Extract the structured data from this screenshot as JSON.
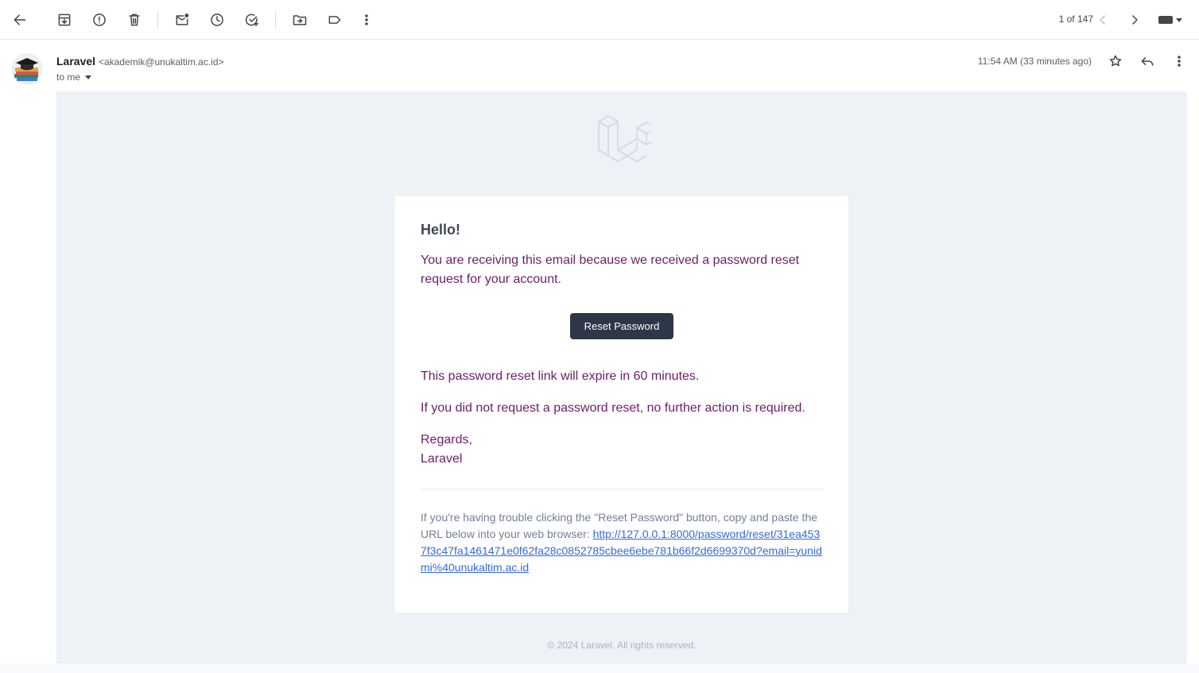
{
  "toolbar": {
    "icons": [
      "back-arrow-icon",
      "archive-icon",
      "report-spam-icon",
      "delete-icon",
      "mark-unread-icon",
      "snooze-icon",
      "add-task-icon",
      "move-to-icon",
      "label-icon",
      "more-vert-icon"
    ],
    "pager": "1 of 147"
  },
  "header": {
    "sender_name": "Laravel",
    "sender_email": "<akademik@unukaltim.ac.id>",
    "to": "to me",
    "time": "11:54 AM (33 minutes ago)"
  },
  "email": {
    "greeting": "Hello!",
    "intro": "You are receiving this email because we received a password reset request for your account.",
    "button_label": "Reset Password",
    "expire": "This password reset link will expire in 60 minutes.",
    "no_action": "If you did not request a password reset, no further action is required.",
    "regards": "Regards,",
    "signature": "Laravel",
    "subcopy_text": "If you're having trouble clicking the \"Reset Password\" button, copy and paste the URL below into your web browser: ",
    "subcopy_url": "http://127.0.0.1:8000/password/reset/31ea4537f3c47fa1461471e0f62fa28c0852785cbee6ebe781b66f2d6699370d?email=yunidmi%40unukaltim.ac.id",
    "footer": "© 2024 Laravel. All rights reserved."
  },
  "colors": {
    "body_text": "#6b1e66",
    "button_bg": "#2d3748",
    "mail_bg": "#edf2f7",
    "link": "#3869d4"
  }
}
